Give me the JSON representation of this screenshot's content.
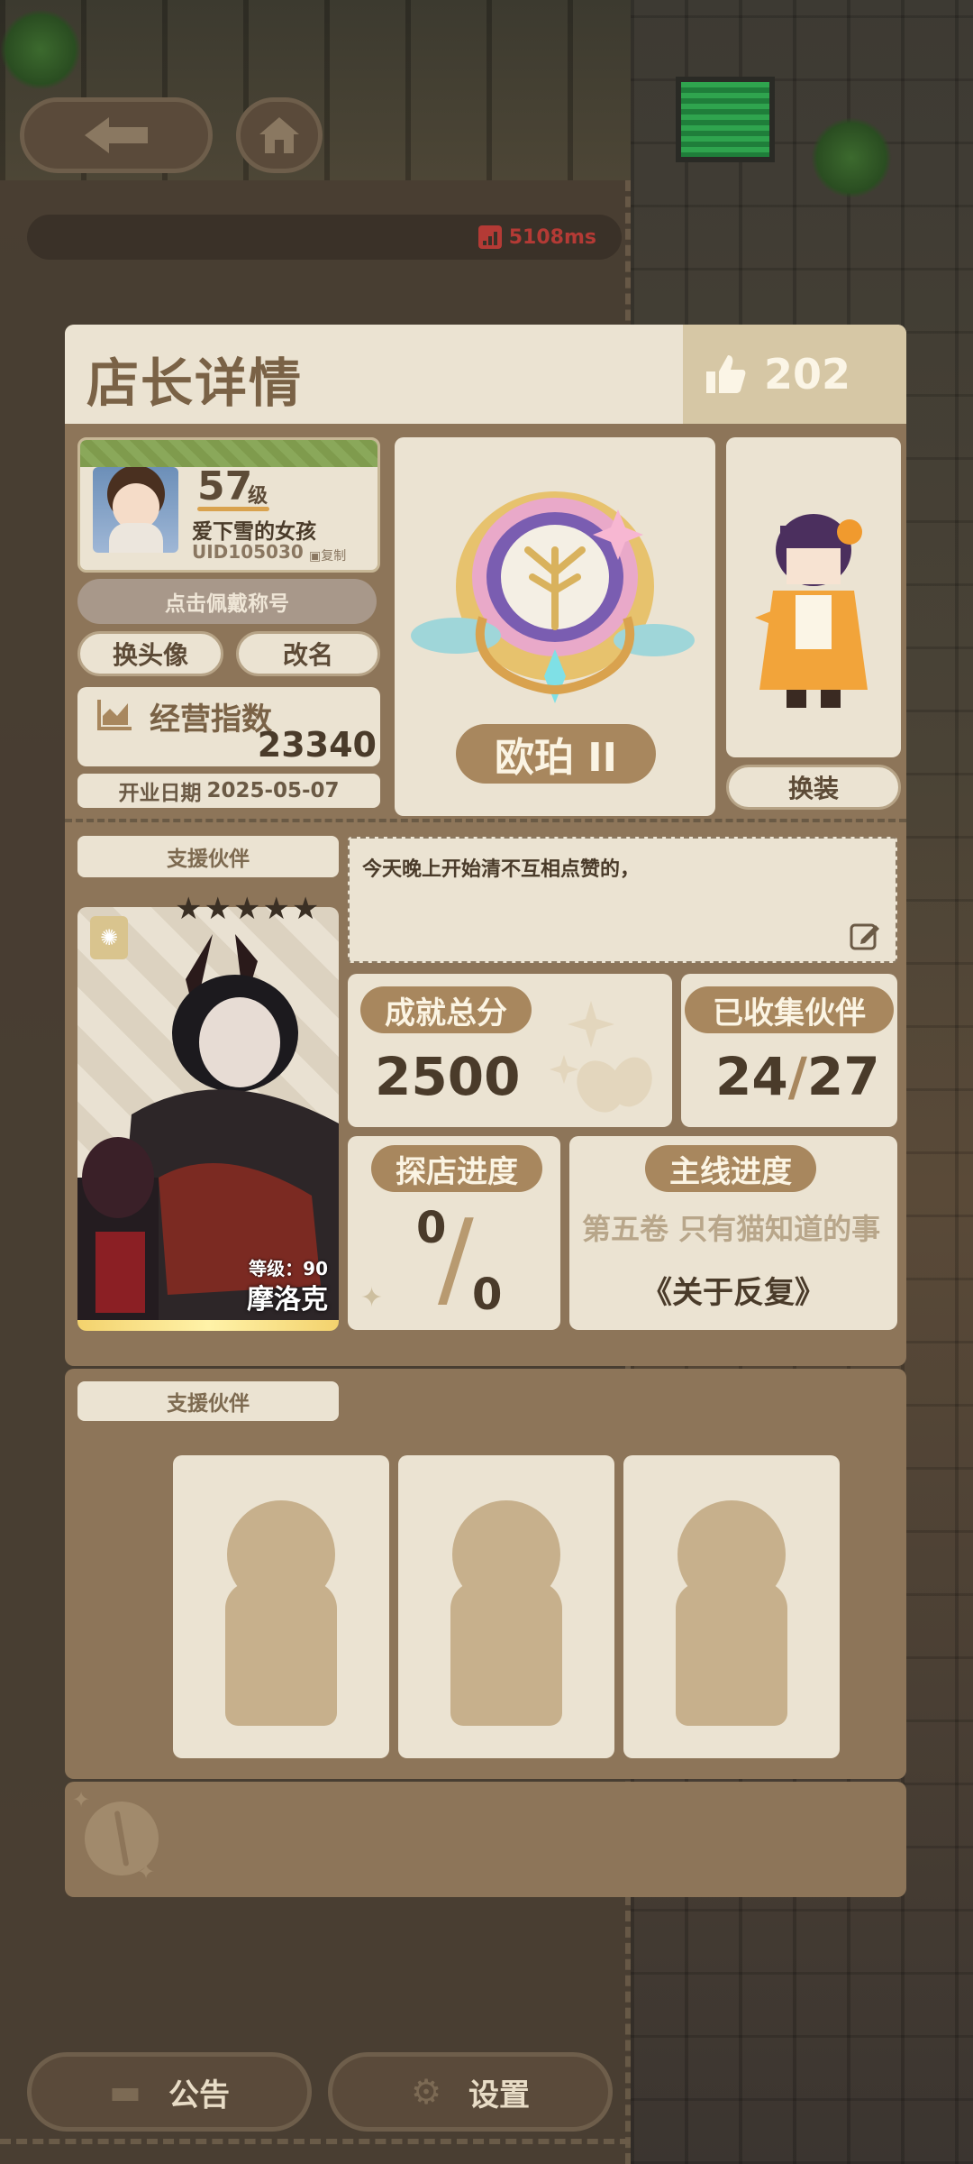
{
  "status": {
    "ping": "5108ms"
  },
  "nav": {
    "back_icon": "arrow-left-icon",
    "home_icon": "home-icon"
  },
  "card": {
    "title": "店长详情",
    "likes": "202",
    "profile": {
      "level": "57",
      "level_unit": "级",
      "nickname": "爱下雪的女孩",
      "uid": "UID105030",
      "copy_label": "复制"
    },
    "wear_title_label": "点击佩戴称号",
    "change_avatar_label": "换头像",
    "rename_label": "改名",
    "business_index_label": "经营指数",
    "business_index_value": "23340",
    "open_date_label": "开业日期",
    "open_date_value": "2025-05-07",
    "rank": "欧珀 II",
    "outfit_label": "换装",
    "support_partner_label": "支援伙伴",
    "hero": {
      "level_label": "等级：90",
      "name": "摩洛克",
      "stars": "★★★★★"
    },
    "message": "今天晚上开始清不互相点赞的，",
    "achievement_label": "成就总分",
    "achievement_value": "2500",
    "collected_label": "已收集伙伴",
    "collected_have": "24",
    "collected_slash": "/",
    "collected_total": "27",
    "explore_label": "探店进度",
    "explore_num": "0",
    "explore_slash": "/",
    "explore_den": "0",
    "main_progress_label": "主线进度",
    "main_progress_volume": "第五卷 只有猫知道的事",
    "main_progress_chapter": "《关于反复》"
  },
  "support_section": {
    "label": "支援伙伴",
    "slots": 3
  },
  "bottom": {
    "notice_label": "公告",
    "settings_label": "设置"
  },
  "colors": {
    "accent": "#a8875e",
    "panel": "#ebe3d2",
    "card": "#8d7559"
  }
}
